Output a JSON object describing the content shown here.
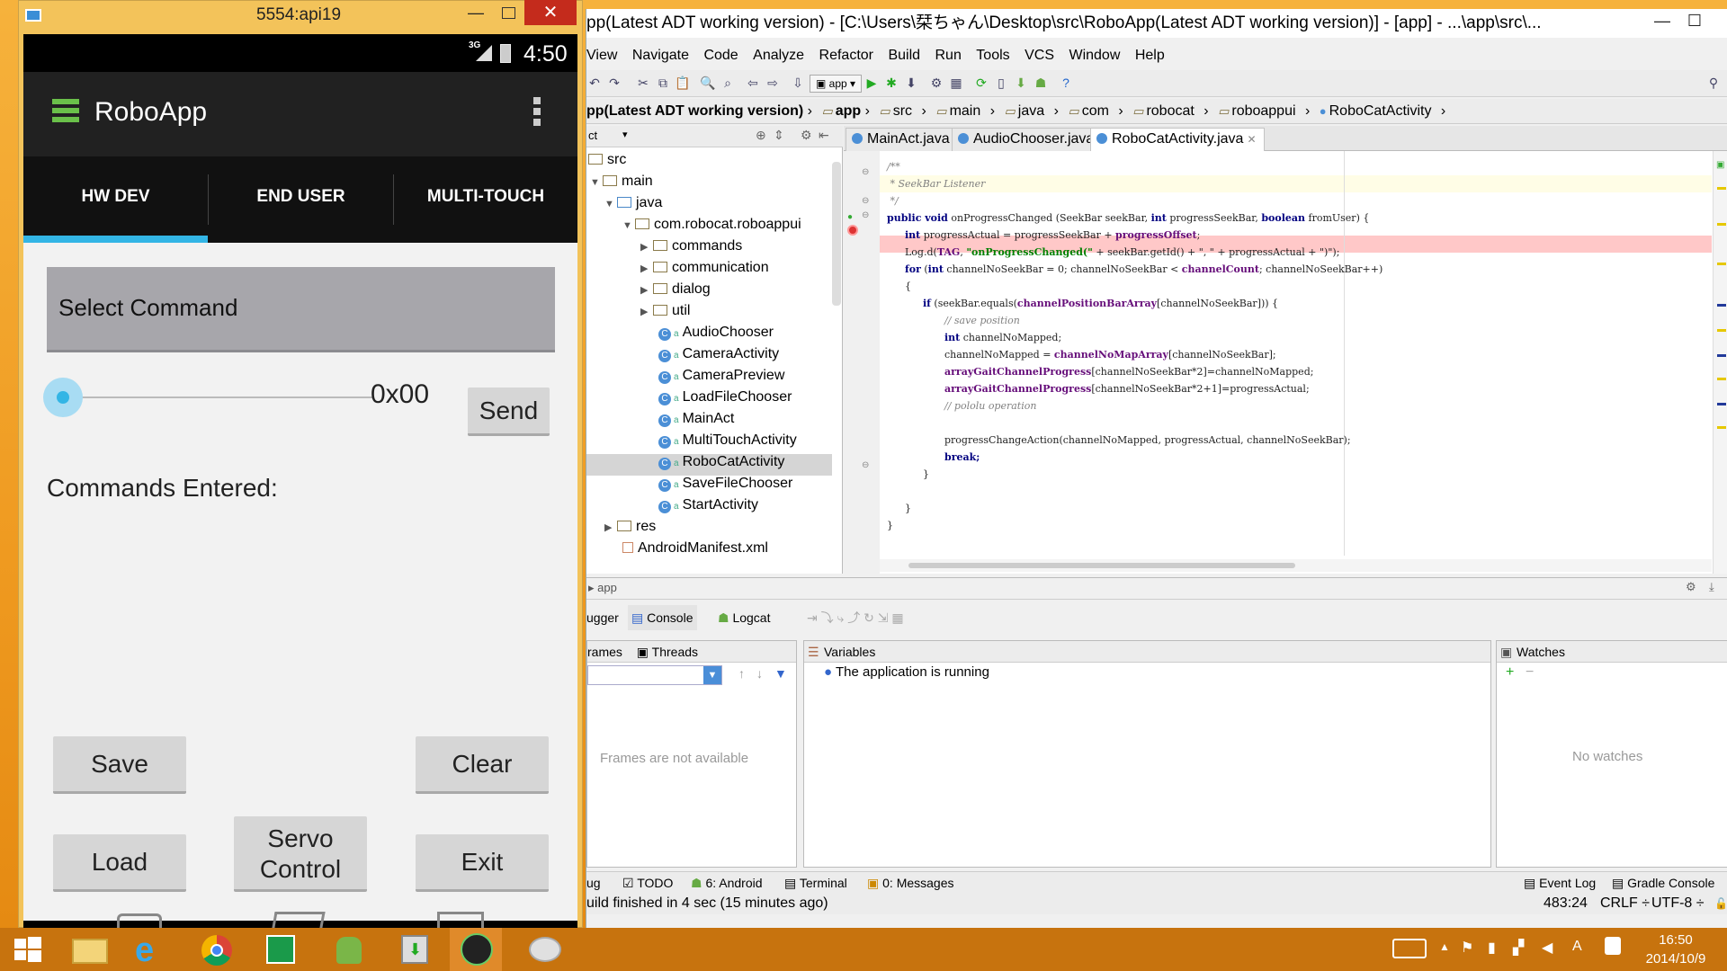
{
  "emulator": {
    "window_title": "5554:api19",
    "status_time": "4:50",
    "network": "3G",
    "app_title": "RoboApp",
    "tabs": [
      "HW DEV",
      "END USER",
      "MULTI-TOUCH"
    ],
    "select_command": "Select Command",
    "slider_value": "0x00",
    "slider_level": 0.0,
    "send": "Send",
    "commands_entered": "Commands Entered:",
    "save": "Save",
    "clear": "Clear",
    "load": "Load",
    "servo": "Servo Control",
    "exit": "Exit"
  },
  "ide": {
    "title": "pp(Latest ADT working version) - [C:\\Users\\栞ちゃん\\Desktop\\src\\RoboApp(Latest ADT working version)] - [app] - ...\\app\\src\\...",
    "menu": [
      "View",
      "Navigate",
      "Code",
      "Analyze",
      "Refactor",
      "Build",
      "Run",
      "Tools",
      "VCS",
      "Window",
      "Help"
    ],
    "run_config": "app",
    "breadcrumbs": [
      "pp(Latest ADT working version)",
      "app",
      "src",
      "main",
      "java",
      "com",
      "robocat",
      "roboappui",
      "RoboCatActivity"
    ],
    "editor_tabs": [
      "MainAct.java",
      "AudioChooser.java",
      "RoboCatActivity.java"
    ],
    "tree": {
      "src": "src",
      "main": "main",
      "java": "java",
      "package": "com.robocat.roboappui",
      "folders": [
        "commands",
        "communication",
        "dialog",
        "util"
      ],
      "classes": [
        "AudioChooser",
        "CameraActivity",
        "CameraPreview",
        "LoadFileChooser",
        "MainAct",
        "MultiTouchActivity",
        "RoboCatActivity",
        "SaveFileChooser",
        "StartActivity"
      ],
      "res": "res",
      "manifest": "AndroidManifest.xml"
    },
    "code": {
      "l1": "/**",
      "l2": " * SeekBar Listener",
      "l3": " */",
      "l4a": "public void",
      "l4b": " onProgressChanged (SeekBar seekBar, ",
      "l4c": "int",
      "l4d": " progressSeekBar, ",
      "l4e": "boolean",
      "l4f": " fromUser) {",
      "l5a": "int",
      "l5b": " progressActual = progressSeekBar + ",
      "l5c": "progressOffset",
      "l5d": ";",
      "l6a": "Log.d(",
      "l6b": "TAG",
      "l6c": ", ",
      "l6d": "\"onProgressChanged(\"",
      "l6e": " + seekBar.getId() + \", \" + progressActual + \")\");",
      "l7a": "for",
      "l7b": " (",
      "l7c": "int",
      "l7d": " channelNoSeekBar = 0; channelNoSeekBar < ",
      "l7e": "channelCount",
      "l7f": "; channelNoSeekBar++)",
      "l8": "{",
      "l9a": "if",
      "l9b": " (seekBar.equals(",
      "l9c": "channelPositionBarArray",
      "l9d": "[channelNoSeekBar])) {",
      "l10": "// save position",
      "l11a": "int",
      "l11b": " channelNoMapped;",
      "l12a": "channelNoMapped = ",
      "l12b": "channelNoMapArray",
      "l12c": "[channelNoSeekBar];",
      "l13a": "arrayGaitChannelProgress",
      "l13b": "[channelNoSeekBar*2]=channelNoMapped;",
      "l14a": "arrayGaitChannelProgress",
      "l14b": "[channelNoSeekBar*2+1]=progressActual;",
      "l15": "// pololu operation",
      "l16": "progressChangeAction(channelNoMapped, progressActual, channelNoSeekBar);",
      "l17": "break;",
      "l18": "}",
      "l19": "}",
      "l20": "}"
    },
    "debug": {
      "label": "app",
      "tabs": [
        "ugger",
        "Console",
        "Logcat"
      ],
      "frames_tab": "rames",
      "threads_tab": "Threads",
      "frames_empty": "Frames are not available",
      "variables": "Variables",
      "running": "The application is running",
      "watches": "Watches",
      "no_watches": "No watches"
    },
    "bottom_tabs": [
      "ug",
      "TODO",
      "6: Android",
      "Terminal",
      "0: Messages"
    ],
    "event_log": "Event Log",
    "gradle_console": "Gradle Console",
    "build_status": "uild finished in 4 sec (15 minutes ago)",
    "position": "483:24",
    "line_sep": "CRLF ÷",
    "encoding": "UTF-8 ÷"
  },
  "taskbar": {
    "time": "16:50",
    "date": "2014/10/9"
  },
  "colors": {
    "accent": "#33b5e5",
    "breakpoint": "#ffc8c8",
    "taskbar": "#c7730e"
  }
}
